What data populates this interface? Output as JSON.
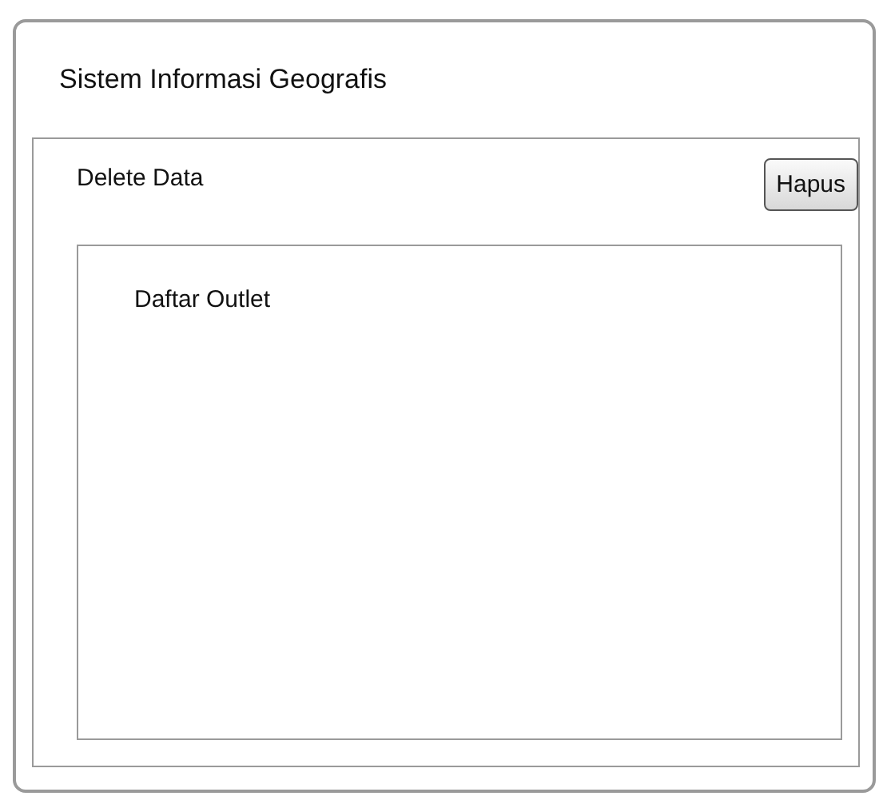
{
  "window": {
    "title": "Sistem Informasi Geografis"
  },
  "panel": {
    "title": "Delete Data",
    "button": "Hapus",
    "list": {
      "title": "Daftar Outlet"
    }
  }
}
